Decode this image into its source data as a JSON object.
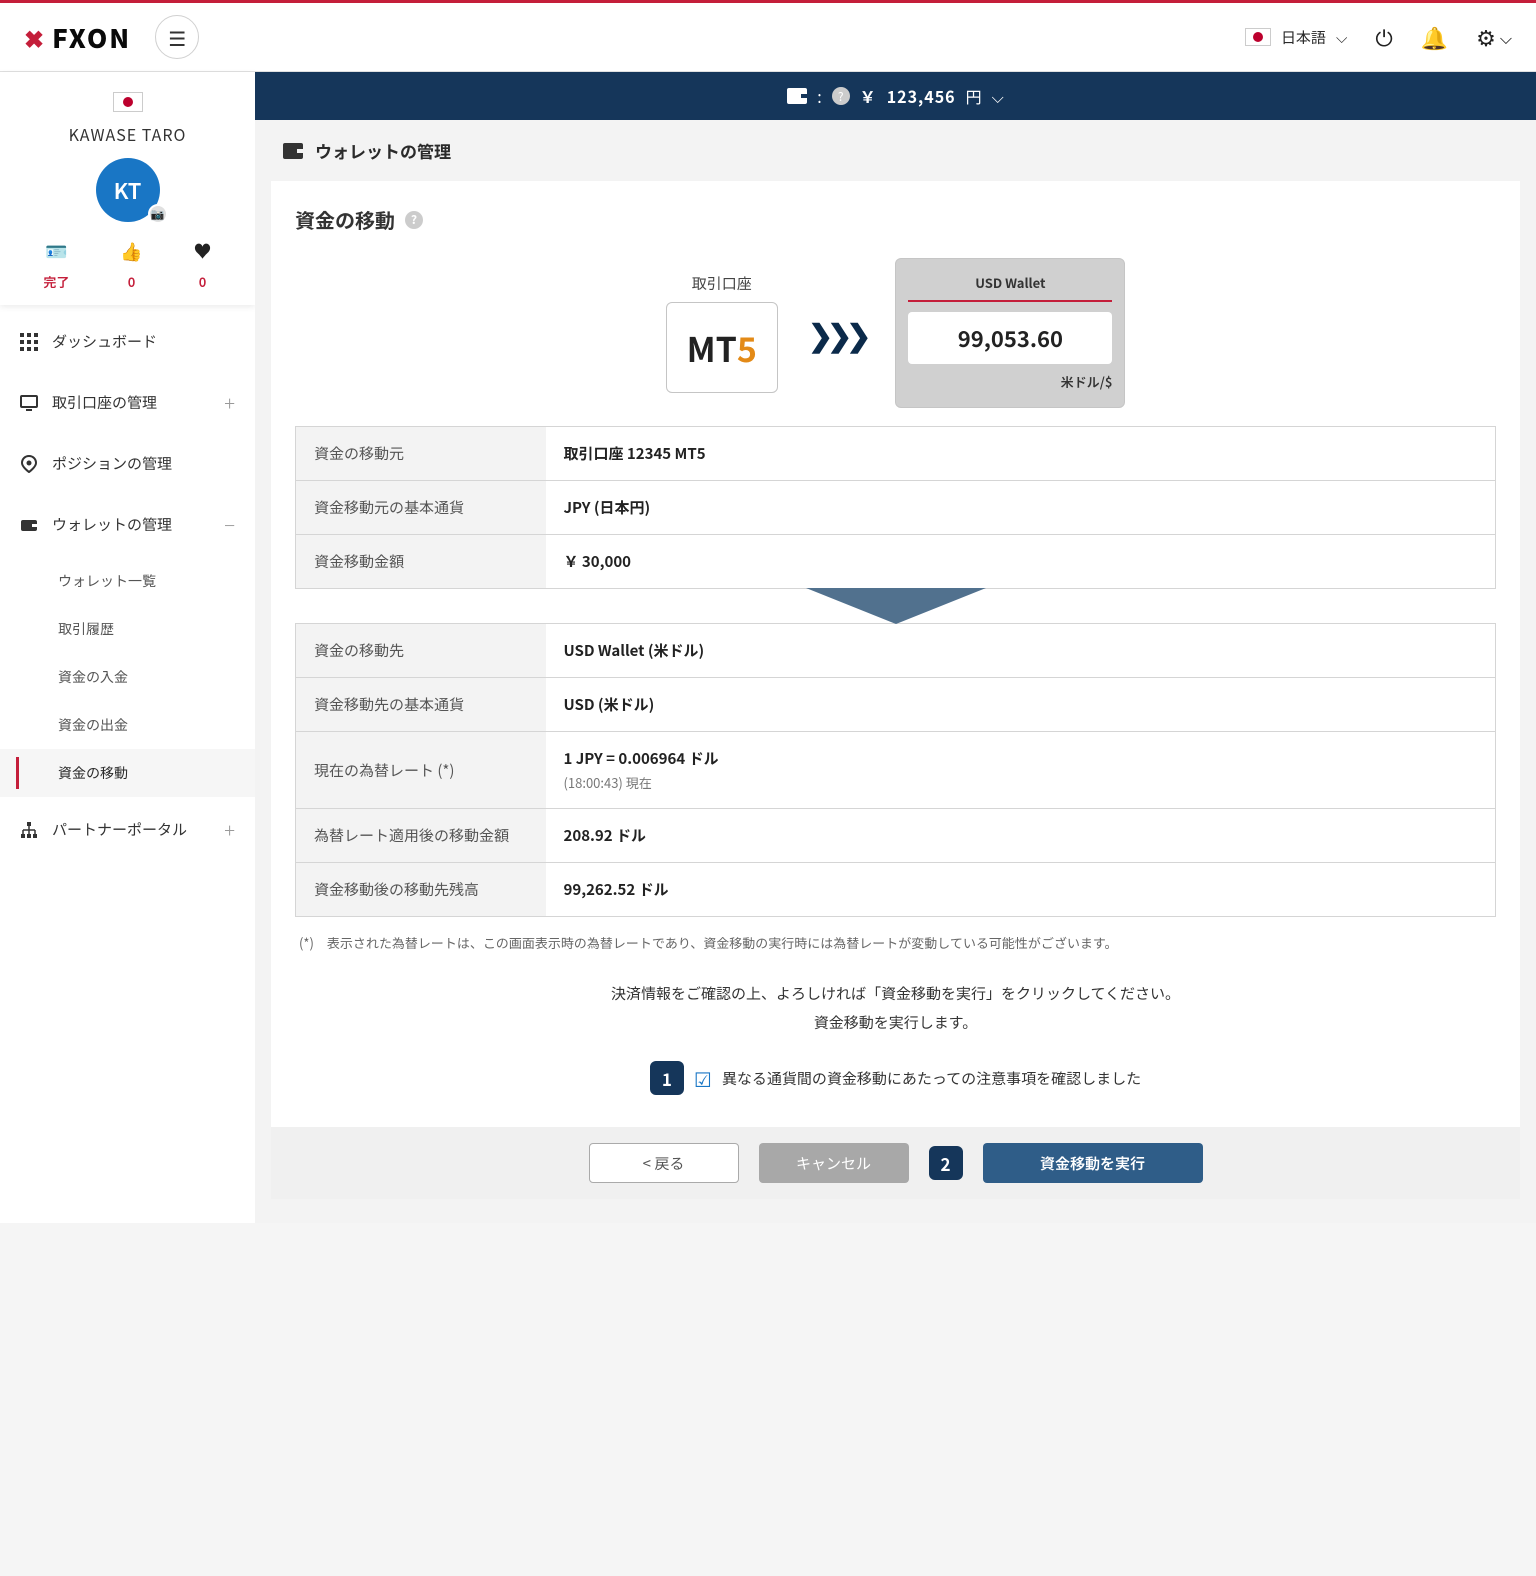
{
  "header": {
    "brand": "FXON",
    "language": "日本語"
  },
  "balance": {
    "symbol": "￥",
    "amount": "123,456",
    "unit": "円"
  },
  "profile": {
    "name": "KAWASE TARO",
    "initials": "KT",
    "stats": {
      "done_label": "完了",
      "likes": "0",
      "hearts": "0"
    }
  },
  "nav": {
    "dashboard": "ダッシュボード",
    "accounts": "取引口座の管理",
    "positions": "ポジションの管理",
    "wallet": "ウォレットの管理",
    "wallet_sub": {
      "list": "ウォレット一覧",
      "history": "取引履歴",
      "deposit": "資金の入金",
      "withdraw": "資金の出金",
      "transfer": "資金の移動"
    },
    "partner": "パートナーポータル"
  },
  "breadcrumb": "ウォレットの管理",
  "section_title": "資金の移動",
  "transfer": {
    "source_label": "取引口座",
    "source_platform_a": "MT",
    "source_platform_b": "5",
    "dest_title": "USD Wallet",
    "dest_amount": "99,053.60",
    "dest_currency": "米ドル/$"
  },
  "table_source": {
    "from_label": "資金の移動元",
    "from_value": "取引口座 12345 MT5",
    "currency_label": "資金移動元の基本通貨",
    "currency_value": "JPY (日本円)",
    "amount_label": "資金移動金額",
    "amount_value": "￥ 30,000"
  },
  "table_dest": {
    "to_label": "資金の移動先",
    "to_value": "USD Wallet (米ドル)",
    "currency_label": "資金移動先の基本通貨",
    "currency_value": "USD (米ドル)",
    "rate_label": "現在の為替レート (*)",
    "rate_value": "1 JPY = 0.006964 ドル",
    "rate_time": "(18:00:43) 現在",
    "converted_label": "為替レート適用後の移動金額",
    "converted_value": "208.92 ドル",
    "balance_label": "資金移動後の移動先残高",
    "balance_value": "99,262.52 ドル"
  },
  "footnote": "(*)　表示された為替レートは、この画面表示時の為替レートであり、資金移動の実行時には為替レートが変動している可能性がございます。",
  "confirm_line1": "決済情報をご確認の上、よろしければ「資金移動を実行」をクリックしてください。",
  "confirm_line2": "資金移動を実行します。",
  "step1_num": "1",
  "check_text": "異なる通貨間の資金移動にあたっての注意事項を確認しました",
  "step2_num": "2",
  "buttons": {
    "back": "< 戻る",
    "cancel": "キャンセル",
    "execute": "資金移動を実行"
  }
}
